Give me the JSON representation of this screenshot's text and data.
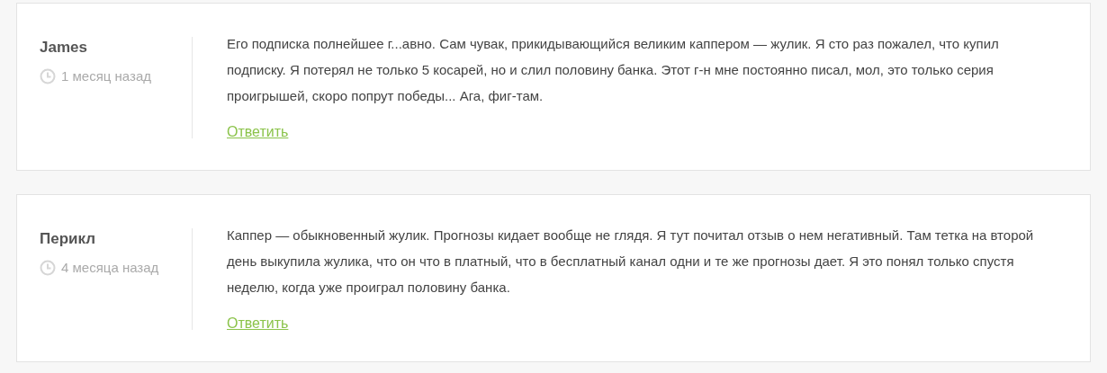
{
  "comments": [
    {
      "author": "James",
      "time": "1 месяц назад",
      "text": "Его подписка полнейшее г...авно. Сам чувак, прикидывающийся великим каппером — жулик. Я сто раз пожалел, что купил подписку. Я потерял не только 5 косарей, но и слил половину банка. Этот г-н мне постоянно писал, мол, это только серия проигрышей, скоро попрут победы... Ага, фиг-там.",
      "reply": "Ответить"
    },
    {
      "author": "Перикл",
      "time": "4 месяца назад",
      "text": "Каппер — обыкновенный жулик. Прогнозы кидает вообще не глядя. Я тут почитал отзыв о нем негативный. Там тетка на второй день выкупила жулика, что он что в платный, что в бесплатный канал одни и те же прогнозы дает. Я это понял только спустя неделю, когда уже проиграл половину банка.",
      "reply": "Ответить"
    }
  ]
}
